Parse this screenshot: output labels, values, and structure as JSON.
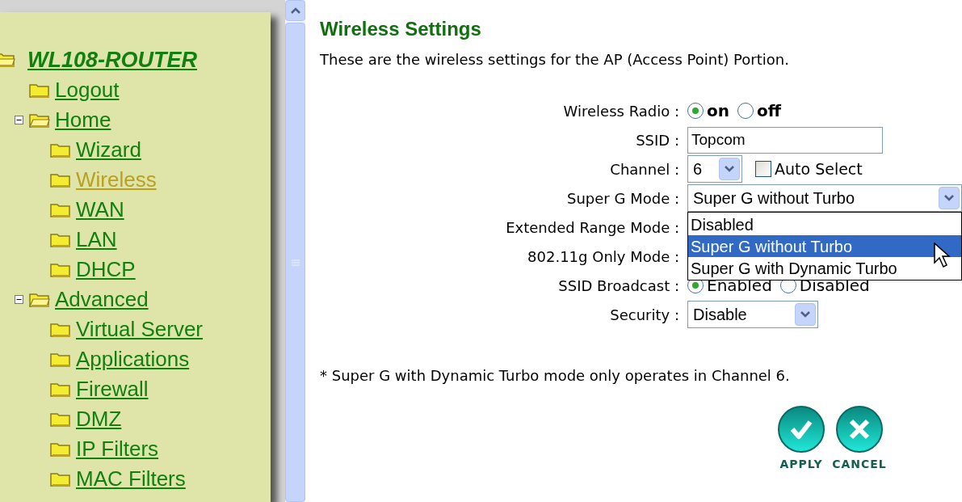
{
  "sidebar": {
    "tree": {
      "label": "WL108-ROUTER",
      "children": [
        {
          "label": "Logout",
          "selected": false
        },
        {
          "label": "Home",
          "selected": false,
          "expanded": true,
          "children": [
            {
              "label": "Wizard",
              "selected": false
            },
            {
              "label": "Wireless",
              "selected": true
            },
            {
              "label": "WAN",
              "selected": false
            },
            {
              "label": "LAN",
              "selected": false
            },
            {
              "label": "DHCP",
              "selected": false
            }
          ]
        },
        {
          "label": "Advanced",
          "selected": false,
          "expanded": true,
          "children": [
            {
              "label": "Virtual Server",
              "selected": false
            },
            {
              "label": "Applications",
              "selected": false
            },
            {
              "label": "Firewall",
              "selected": false
            },
            {
              "label": "DMZ",
              "selected": false
            },
            {
              "label": "IP Filters",
              "selected": false
            },
            {
              "label": "MAC Filters",
              "selected": false
            }
          ]
        }
      ]
    }
  },
  "main": {
    "title": "Wireless Settings",
    "subtitle": "These are the wireless settings for the AP (Access Point) Portion.",
    "form": [
      {
        "kind": "radio",
        "label": "Wireless Radio :",
        "bold": true,
        "options": [
          {
            "label": "on",
            "selected": true
          },
          {
            "label": "off",
            "selected": false
          }
        ]
      },
      {
        "kind": "text",
        "label": "SSID :",
        "value": "Topcom"
      },
      {
        "kind": "select",
        "label": "Channel :",
        "value": "6",
        "checkbox": {
          "label": "Auto Select",
          "checked": false
        }
      },
      {
        "kind": "select",
        "label": "Super G Mode :",
        "value": "Super G without Turbo",
        "wide": true,
        "open": true,
        "options": [
          {
            "label": "Disabled",
            "selected": false
          },
          {
            "label": "Super G without Turbo",
            "selected": true
          },
          {
            "label": "Super G with Dynamic Turbo",
            "selected": false
          }
        ]
      },
      {
        "kind": "covered",
        "label": "Extended Range Mode :"
      },
      {
        "kind": "covered",
        "label": "802.11g Only Mode :"
      },
      {
        "kind": "radio",
        "label": "SSID Broadcast :",
        "bold": false,
        "options": [
          {
            "label": "Enabled",
            "selected": true
          },
          {
            "label": "Disabled",
            "selected": false
          }
        ]
      },
      {
        "kind": "select",
        "label": "Security :",
        "value": "Disable"
      }
    ],
    "note": "* Super G with Dynamic Turbo mode only operates in Channel 6.",
    "buttons": [
      {
        "kind": "apply",
        "label": "APPLY"
      },
      {
        "kind": "cancel",
        "label": "CANCEL"
      }
    ]
  }
}
